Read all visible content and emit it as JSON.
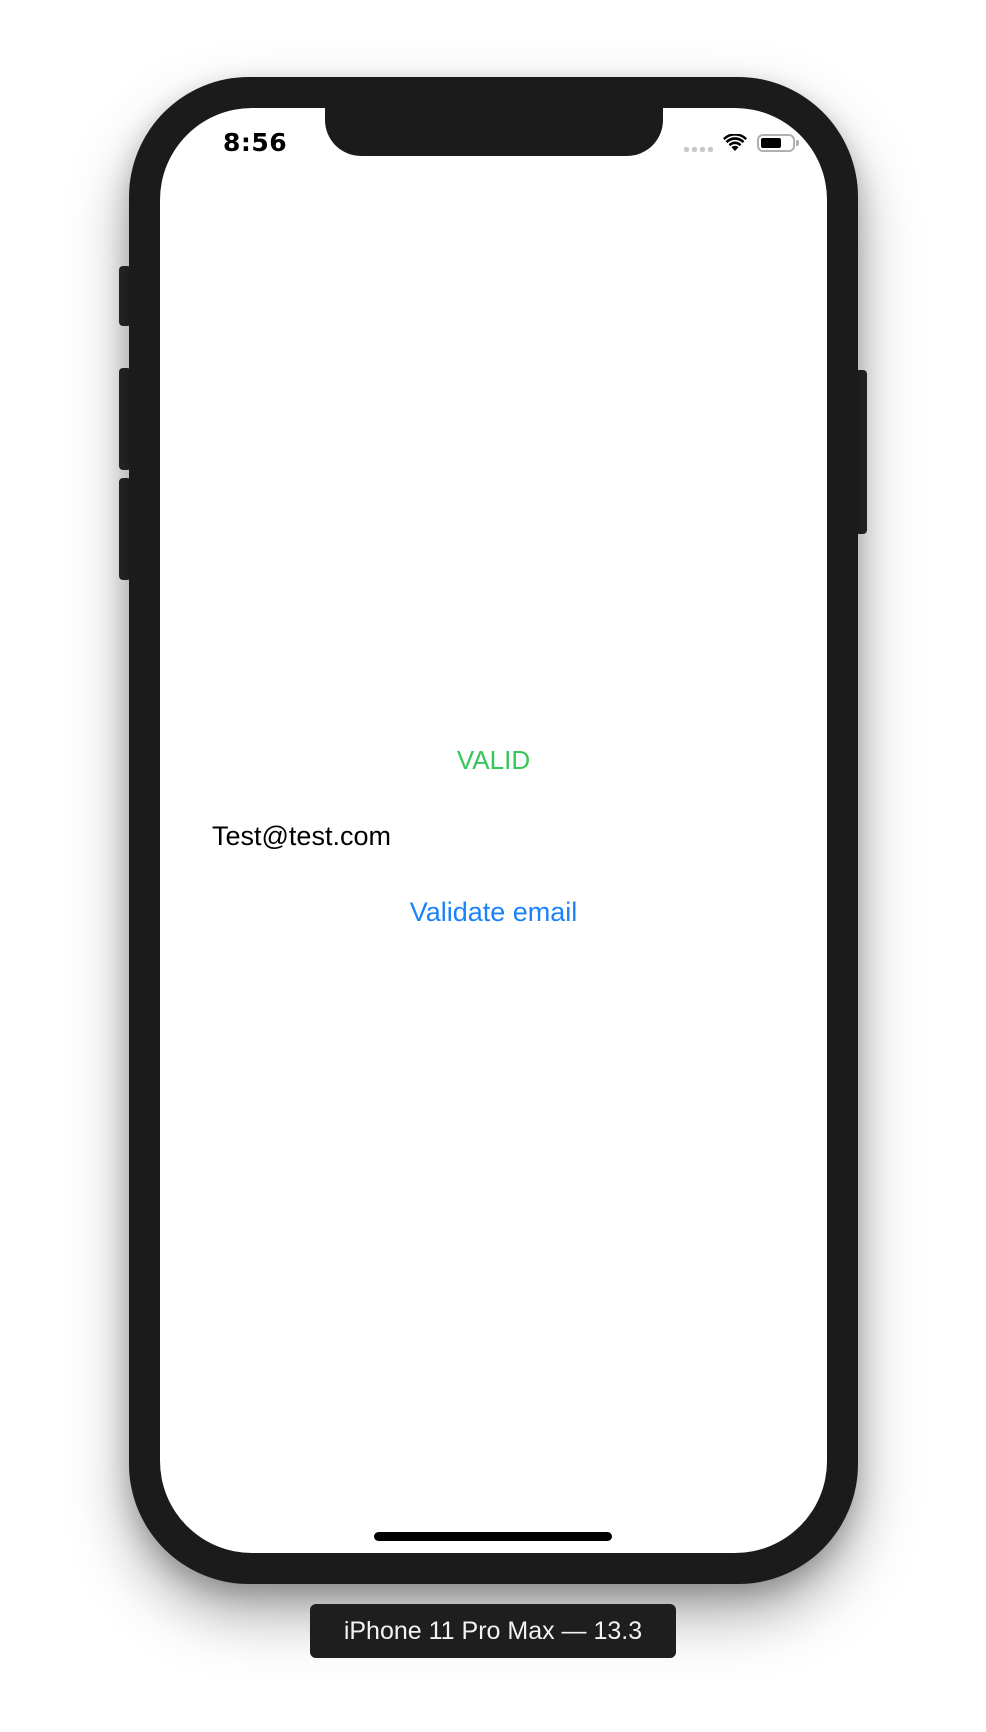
{
  "status_bar": {
    "time": "8:56",
    "battery_level": 0.65,
    "signal_bars": 4
  },
  "main": {
    "result_label": "VALID",
    "email_value": "Test@test.com",
    "validate_button_label": "Validate email"
  },
  "colors": {
    "valid": "#34c759",
    "button": "#1a82fb"
  },
  "icons": {
    "signal": "cellular-signal-icon",
    "wifi": "wifi-icon",
    "battery": "battery-icon"
  },
  "simulator": {
    "device_label": "iPhone 11 Pro Max — 13.3"
  }
}
